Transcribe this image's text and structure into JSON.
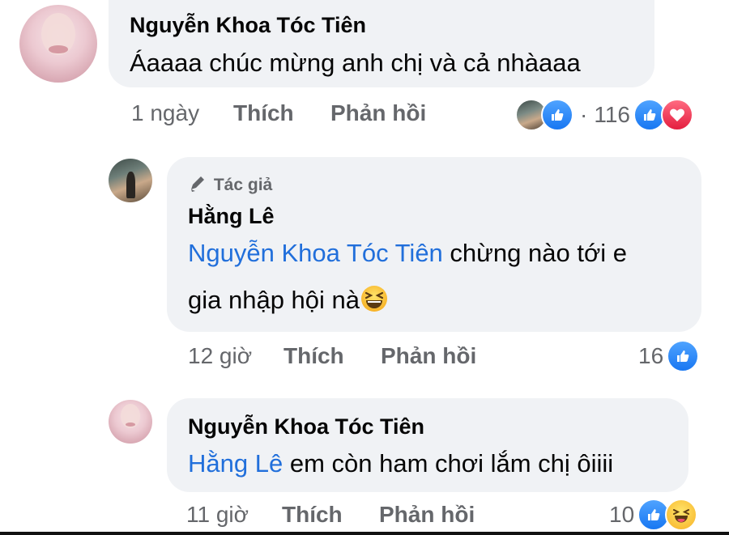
{
  "comments": [
    {
      "author": "Nguyễn Khoa Tóc Tiên",
      "text": "Áaaaa chúc mừng anh chị và cả nhàaaa",
      "time": "1 ngày",
      "like_label": "Thích",
      "reply_label": "Phản hồi",
      "reaction_count": "116",
      "reactions": [
        "avatar",
        "like-icon",
        "like-icon",
        "love-icon"
      ]
    },
    {
      "badge": "Tác giả",
      "author": "Hằng Lê",
      "mention": "Nguyễn Khoa Tóc Tiên",
      "text_line1": " chừng nào tới e",
      "text_line2": "gia nhập hội nà",
      "emoji": "grinning-squinting-face-icon",
      "time": "12 giờ",
      "like_label": "Thích",
      "reply_label": "Phản hồi",
      "reaction_count": "16",
      "reactions": [
        "like-icon"
      ]
    },
    {
      "author": "Nguyễn Khoa Tóc Tiên",
      "mention": "Hằng Lê",
      "text": " em còn ham chơi lắm chị ôiiii",
      "time": "11 giờ",
      "like_label": "Thích",
      "reply_label": "Phản hồi",
      "reaction_count": "10",
      "reactions": [
        "like-icon",
        "haha-icon"
      ]
    }
  ],
  "colors": {
    "bubble": "#f0f2f5",
    "mention": "#216fdb",
    "meta": "#65676b",
    "like": "#1877f2",
    "love": "#e41e3f",
    "haha": "#f7b125"
  }
}
